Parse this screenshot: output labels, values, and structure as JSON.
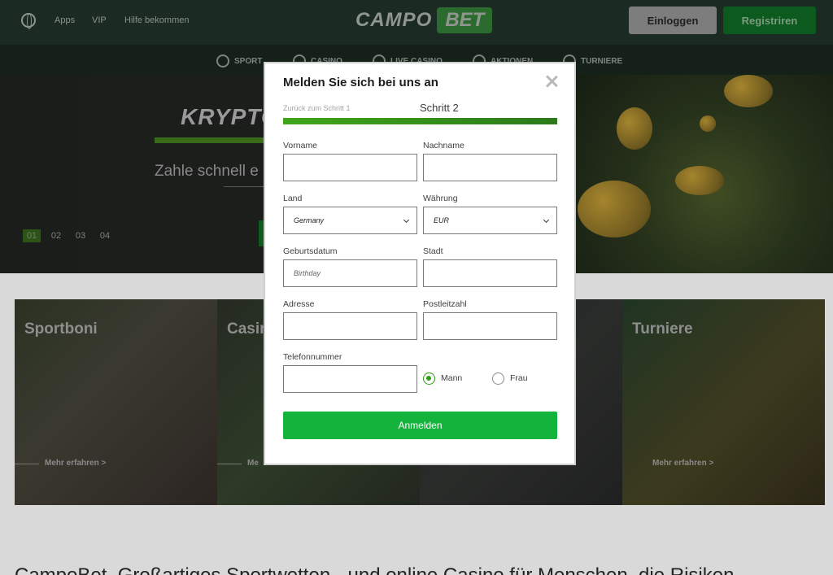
{
  "header": {
    "links": [
      "Apps",
      "VIP",
      "Hilfe bekommen"
    ],
    "logo_left": "CAMPO",
    "logo_right": "BET",
    "login_label": "Einloggen",
    "register_label": "Registriren"
  },
  "nav": {
    "items": [
      "SPORT",
      "CASINO",
      "LIVE CASINO",
      "AKTIONEN",
      "TURNIERE"
    ]
  },
  "hero": {
    "title": "KRYPTO",
    "subtitle": "Zahle schnell e",
    "pager": [
      "01",
      "02",
      "03",
      "04"
    ]
  },
  "cards": [
    {
      "title": "Sportboni",
      "more": "Mehr erfahren >"
    },
    {
      "title": "Casin",
      "more": "Me"
    },
    {
      "title": "",
      "more": ""
    },
    {
      "title": "Turniere",
      "more": "Mehr erfahren >"
    }
  ],
  "bottom_text": "CampoBet. Großartiges Sportwetten - und online Casino für Menschen, die Risiken",
  "modal": {
    "title": "Melden Sie sich bei uns an",
    "back_step": "Zurück zum Schritt 1",
    "current_step": "Schritt 2",
    "fields": {
      "first_name": {
        "label": "Vorname",
        "value": ""
      },
      "last_name": {
        "label": "Nachname",
        "value": ""
      },
      "country": {
        "label": "Land",
        "value": "Germany"
      },
      "currency": {
        "label": "Währung",
        "value": "EUR"
      },
      "birthdate": {
        "label": "Geburtsdatum",
        "placeholder": "Birthday"
      },
      "city": {
        "label": "Stadt",
        "value": ""
      },
      "address": {
        "label": "Adresse",
        "value": ""
      },
      "postcode": {
        "label": "Postleitzahl",
        "value": ""
      },
      "phone": {
        "label": "Telefonnummer",
        "value": ""
      }
    },
    "gender": {
      "male": "Mann",
      "female": "Frau",
      "selected": "male"
    },
    "submit_label": "Anmelden",
    "accent_color": "#14b43c"
  }
}
